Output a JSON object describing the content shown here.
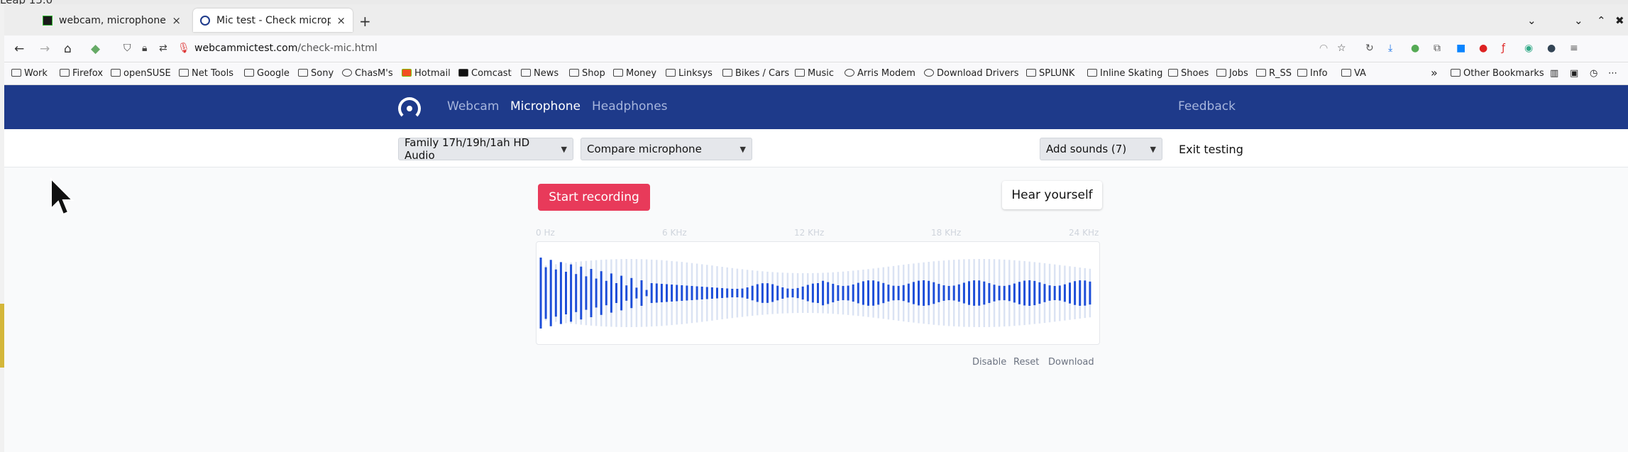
{
  "desktop": {
    "partial_text": "Leap 15.0"
  },
  "tabs": [
    {
      "title": "webcam, microphone not",
      "close": "×"
    },
    {
      "title": "Mic test - Check micropho",
      "close": "×"
    }
  ],
  "new_tab": "+",
  "url": {
    "host": "webcammictest.com",
    "path": "/check-mic.html"
  },
  "bookmarks": [
    "Work",
    "Firefox",
    "openSUSE",
    "Net Tools",
    "Google",
    "Sony",
    "ChasM's",
    "Hotmail",
    "Comcast",
    "News",
    "Shop",
    "Money",
    "Linksys",
    "Bikes / Cars",
    "Music",
    "Arris Modem",
    "Download Drivers",
    "SPLUNK",
    "Inline Skating",
    "Shoes",
    "Jobs",
    "R_SS",
    "Info",
    "VA"
  ],
  "bookmarks_overflow": "»",
  "other_bookmarks": "Other Bookmarks",
  "site_nav": {
    "webcam": "Webcam",
    "microphone": "Microphone",
    "headphones": "Headphones",
    "feedback": "Feedback"
  },
  "controls": {
    "device": "Family 17h/19h/1ah HD Audio",
    "compare": "Compare microphone",
    "add_sounds": "Add sounds (7)",
    "exit": "Exit testing"
  },
  "main": {
    "record": "Start recording",
    "hear": "Hear yourself",
    "freq_labels": [
      "0 Hz",
      "6 KHz",
      "12 KHz",
      "18 KHz",
      "24 KHz"
    ],
    "actions": {
      "disable": "Disable",
      "reset": "Reset",
      "download": "Download"
    }
  },
  "colors": {
    "brand": "#1e3a8a",
    "record": "#e83a5a",
    "wave": "#1d4ed8"
  }
}
